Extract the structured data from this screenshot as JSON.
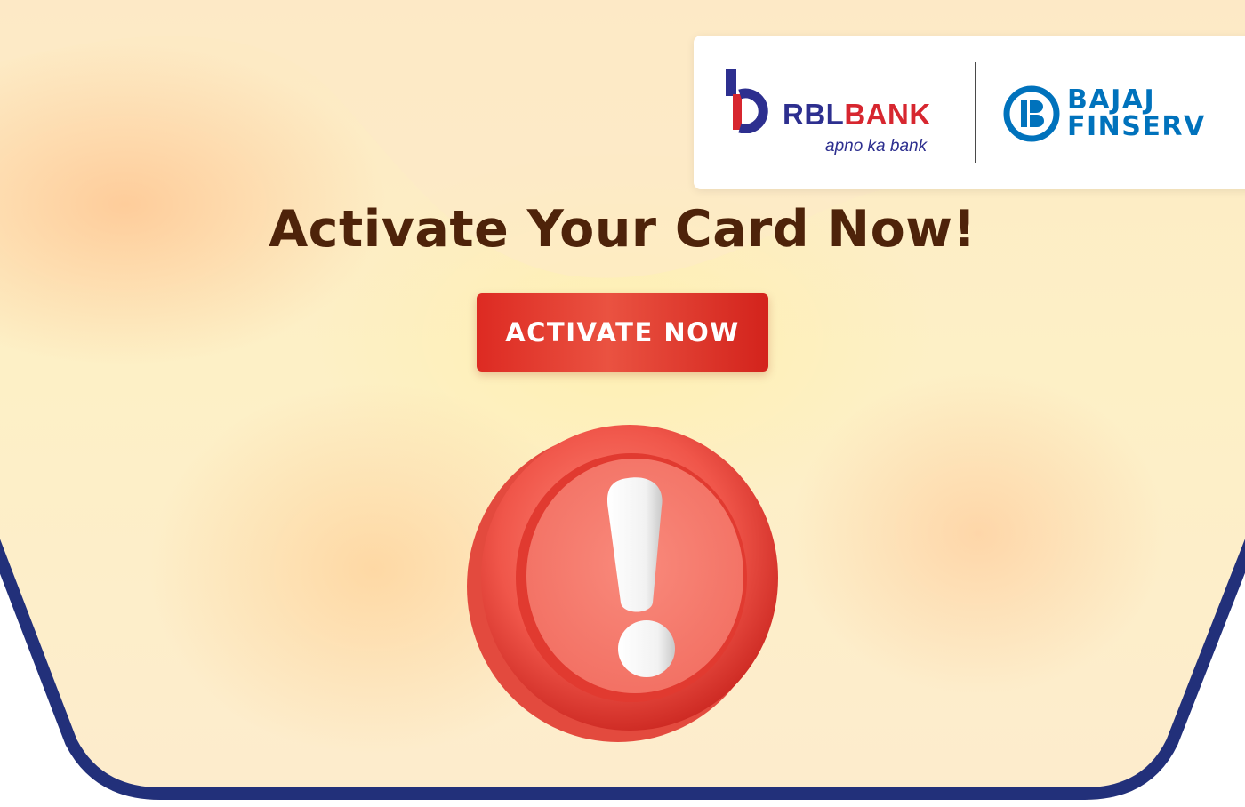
{
  "logos": {
    "rbl": {
      "word_rbl": "RBL",
      "word_bank": "BANK",
      "tagline": "apno ka bank"
    },
    "bajaj": {
      "line1": "BAJAJ",
      "line2": "FINSERV"
    }
  },
  "headline": "Activate Your Card Now!",
  "cta": {
    "label": "ACTIVATE NOW"
  },
  "icons": {
    "alert": "exclamation-alert-icon"
  },
  "colors": {
    "headline": "#4e230a",
    "cta_bg": "#dd2a22",
    "frame": "#22307a",
    "rbl_blue": "#2d2f8f",
    "rbl_red": "#d7262f",
    "bajaj_blue": "#0072bc"
  }
}
